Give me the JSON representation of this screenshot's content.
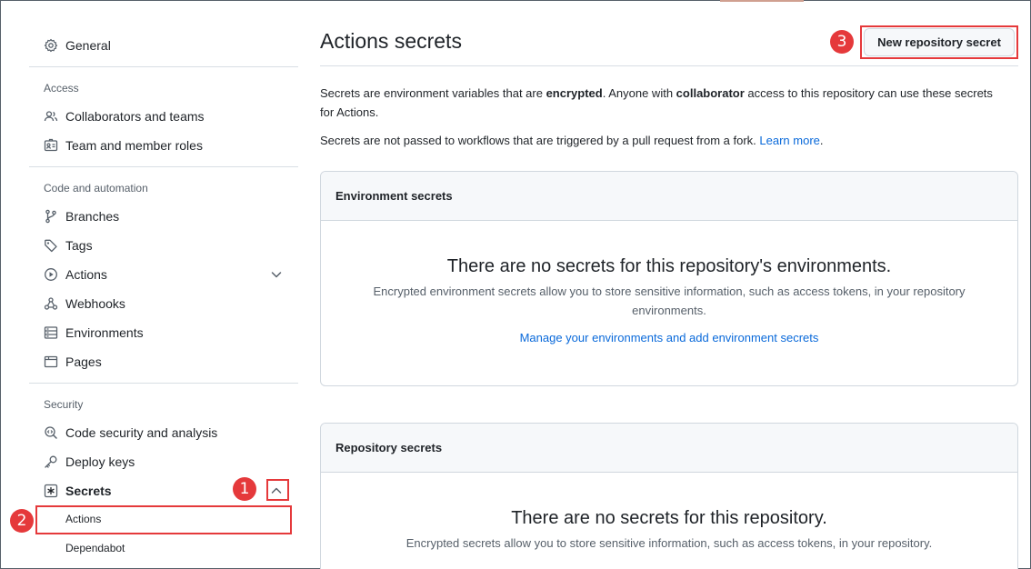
{
  "sidebar": {
    "general": "General",
    "access_label": "Access",
    "collaborators": "Collaborators and teams",
    "team_roles": "Team and member roles",
    "code_automation_label": "Code and automation",
    "branches": "Branches",
    "tags": "Tags",
    "actions": "Actions",
    "webhooks": "Webhooks",
    "environments": "Environments",
    "pages": "Pages",
    "security_label": "Security",
    "code_security": "Code security and analysis",
    "deploy_keys": "Deploy keys",
    "secrets": "Secrets",
    "secrets_actions": "Actions",
    "secrets_dependabot": "Dependabot"
  },
  "callouts": {
    "one": "1",
    "two": "2",
    "three": "3"
  },
  "main": {
    "title": "Actions secrets",
    "new_secret_button": "New repository secret",
    "intro_1a": "Secrets are environment variables that are ",
    "intro_1b": "encrypted",
    "intro_1c": ". Anyone with ",
    "intro_1d": "collaborator",
    "intro_1e": " access to this repository can use these secrets for Actions.",
    "intro_2": "Secrets are not passed to workflows that are triggered by a pull request from a fork. ",
    "learn_more": "Learn more",
    "intro_2_end": ".",
    "env_box": {
      "header": "Environment secrets",
      "empty_title": "There are no secrets for this repository's environments.",
      "empty_desc": "Encrypted environment secrets allow you to store sensitive information, such as access tokens, in your repository environments.",
      "link": "Manage your environments and add environment secrets"
    },
    "repo_box": {
      "header": "Repository secrets",
      "empty_title": "There are no secrets for this repository.",
      "empty_desc": "Encrypted secrets allow you to store sensitive information, such as access tokens, in your repository."
    }
  },
  "colors": {
    "accent": "#0969da",
    "callout": "#e5393b"
  }
}
